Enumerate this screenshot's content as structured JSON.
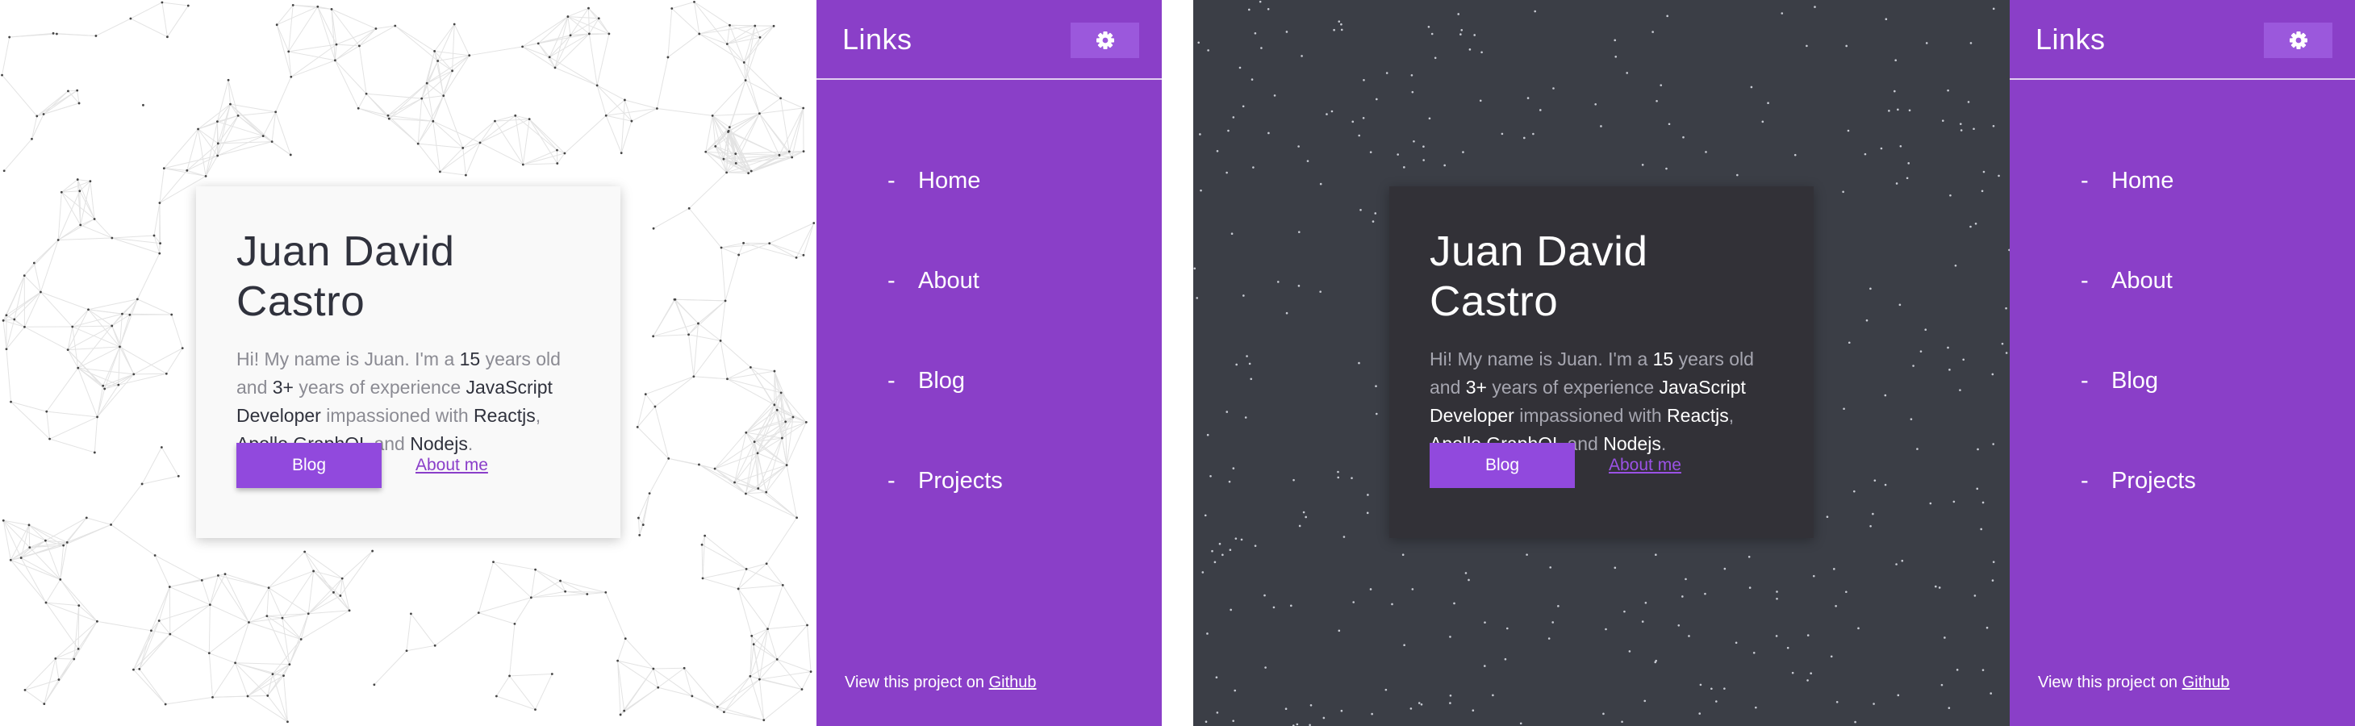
{
  "screens": [
    {
      "theme": "light",
      "card": {
        "title": "Juan David Castro",
        "bio": [
          {
            "text": "Hi! My name is Juan. I'm a ",
            "hl": false
          },
          {
            "text": "15",
            "hl": true
          },
          {
            "text": " years old and ",
            "hl": false
          },
          {
            "text": "3+",
            "hl": true
          },
          {
            "text": " years of experience ",
            "hl": false
          },
          {
            "text": "JavaScript Developer",
            "hl": true
          },
          {
            "text": " impassioned with ",
            "hl": false
          },
          {
            "text": "Reactjs",
            "hl": true
          },
          {
            "text": ", ",
            "hl": false
          },
          {
            "text": "Apollo GraphQL",
            "hl": true
          },
          {
            "text": " and ",
            "hl": false
          },
          {
            "text": "Nodejs",
            "hl": true
          },
          {
            "text": ".",
            "hl": false
          }
        ],
        "blog_button": "Blog",
        "about_link": "About me"
      },
      "sidebar": {
        "title": "Links",
        "settings_icon": "gear-icon",
        "nav": [
          "Home",
          "About",
          "Blog",
          "Projects"
        ],
        "footer_text": "View this project on ",
        "footer_link": "Github"
      }
    },
    {
      "theme": "dark",
      "card": {
        "title": "Juan David Castro",
        "bio": [
          {
            "text": "Hi! My name is Juan. I'm a ",
            "hl": false
          },
          {
            "text": "15",
            "hl": true
          },
          {
            "text": " years old and ",
            "hl": false
          },
          {
            "text": "3+",
            "hl": true
          },
          {
            "text": " years of experience ",
            "hl": false
          },
          {
            "text": "JavaScript Developer",
            "hl": true
          },
          {
            "text": " impassioned with ",
            "hl": false
          },
          {
            "text": "Reactjs",
            "hl": true
          },
          {
            "text": ", ",
            "hl": false
          },
          {
            "text": "Apollo GraphQL",
            "hl": true
          },
          {
            "text": " and ",
            "hl": false
          },
          {
            "text": "Nodejs",
            "hl": true
          },
          {
            "text": ".",
            "hl": false
          }
        ],
        "blog_button": "Blog",
        "about_link": "About me"
      },
      "sidebar": {
        "title": "Links",
        "settings_icon": "gear-icon",
        "nav": [
          "Home",
          "About",
          "Blog",
          "Projects"
        ],
        "footer_text": "View this project on ",
        "footer_link": "Github"
      }
    }
  ],
  "colors": {
    "accent": "#8a3fc8",
    "button": "#9149dd",
    "light_background": "#ffffff",
    "dark_background": "#3b3e46",
    "dark_card": "#323137"
  }
}
